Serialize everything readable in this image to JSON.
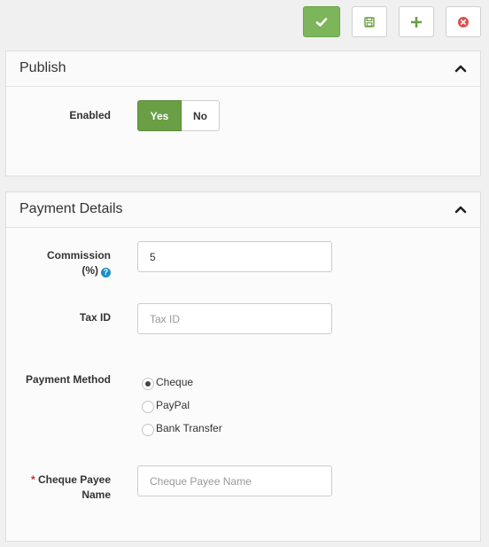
{
  "toolbar": {
    "save_close_icon": "check-icon",
    "save_icon": "floppy-disk-icon",
    "new_icon": "plus-icon",
    "cancel_icon": "close-circle-icon",
    "colors": {
      "primary": "#7db55a",
      "plus": "#6a9f45",
      "close": "#d9534f"
    }
  },
  "publish": {
    "title": "Publish",
    "enabled_label": "Enabled",
    "yes_label": "Yes",
    "no_label": "No",
    "selected": "Yes"
  },
  "payment": {
    "title": "Payment Details",
    "commission_label_line1": "Commission",
    "commission_label_line2": "(%)",
    "commission_help": "?",
    "commission_value": "5",
    "tax_label": "Tax ID",
    "tax_placeholder": "Tax ID",
    "method_label": "Payment Method",
    "methods": [
      {
        "label": "Cheque",
        "checked": true
      },
      {
        "label": "PayPal",
        "checked": false
      },
      {
        "label": "Bank Transfer",
        "checked": false
      }
    ],
    "payee_required_mark": "*",
    "payee_label_line1": "Cheque Payee",
    "payee_label_line2": "Name",
    "payee_placeholder": "Cheque Payee Name"
  }
}
